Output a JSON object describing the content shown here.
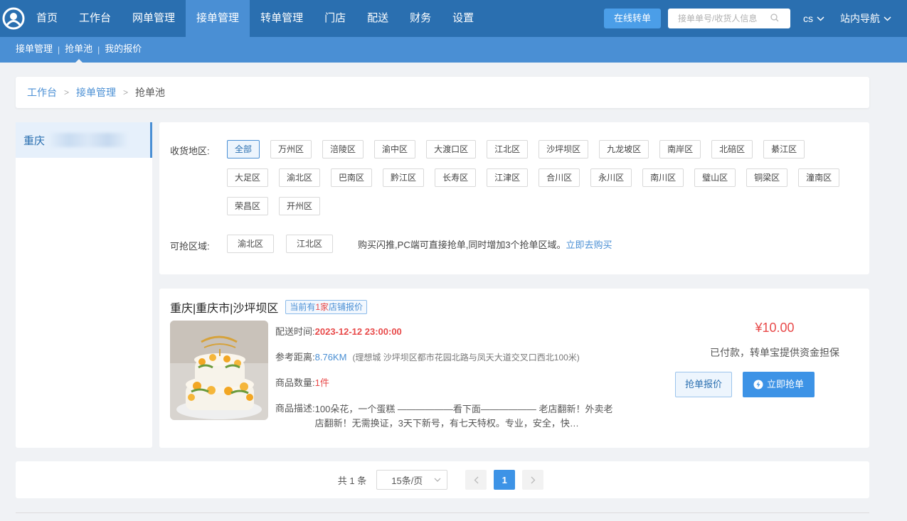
{
  "nav": {
    "items": [
      "首页",
      "工作台",
      "网单管理",
      "接单管理",
      "转单管理",
      "门店",
      "配送",
      "财务",
      "设置"
    ],
    "active_index": 3,
    "online_transfer_label": "在线转单",
    "search_placeholder": "接单单号/收货人信息",
    "user_label": "cs",
    "site_nav_label": "站内导航"
  },
  "subnav": {
    "items": [
      "接单管理",
      "抢单池",
      "我的报价"
    ],
    "active_index": 1
  },
  "breadcrumb": {
    "items": [
      "工作台",
      "接单管理",
      "抢单池"
    ]
  },
  "city_panel": {
    "city": "重庆"
  },
  "filter": {
    "region_label": "收货地区:",
    "regions": [
      "全部",
      "万州区",
      "涪陵区",
      "渝中区",
      "大渡口区",
      "江北区",
      "沙坪坝区",
      "九龙坡区",
      "南岸区",
      "北碚区",
      "綦江区",
      "大足区",
      "渝北区",
      "巴南区",
      "黔江区",
      "长寿区",
      "江津区",
      "合川区",
      "永川区",
      "南川区",
      "璧山区",
      "铜梁区",
      "潼南区",
      "荣昌区",
      "开州区"
    ],
    "active_region_index": 0,
    "grab_label": "可抢区域:",
    "grab_regions": [
      "渝北区",
      "江北区"
    ],
    "promo_text": "购买闪推,PC端可直接抢单,同时增加3个抢单区域。",
    "promo_link": "立即去购买"
  },
  "order": {
    "location": "重庆|重庆市|沙坪坝区",
    "badge_prefix": "当前有",
    "badge_count": "1家",
    "badge_suffix": "店铺报价",
    "time_label": "配送时间:",
    "time_value": "2023-12-12 23:00:00",
    "distance_label": "参考距离:",
    "distance_value": "8.76KM",
    "address": "(理想城 沙坪坝区都市花园北路与凤天大道交叉口西北100米)",
    "qty_label": "商品数量:",
    "qty_value": "1件",
    "desc_label": "商品描述:",
    "desc_value": "100朵花，一个蛋糕 ——————看下面—————— 老店翻新！外卖老店翻新！无需换证，3天下新号，有七天特权。专业，安全，快…",
    "price": "¥10.00",
    "paid_note": "已付款，转单宝提供资金担保",
    "quote_button": "抢单报价",
    "grab_button": "立即抢单"
  },
  "pager": {
    "total": "共 1 条",
    "page_size": "15条/页",
    "current_page": "1"
  },
  "colors": {
    "nav_bg": "#2a6fb0",
    "subnav_bg": "#4a8fd4",
    "accent": "#3d93e6",
    "price_red": "#e84a4a"
  },
  "icons": {
    "logo": "brand-logo-icon",
    "search": "search-icon",
    "dropdown": "chevron-down-icon",
    "grab": "lightning-icon",
    "prev": "chevron-left-icon",
    "next": "chevron-right-icon"
  }
}
